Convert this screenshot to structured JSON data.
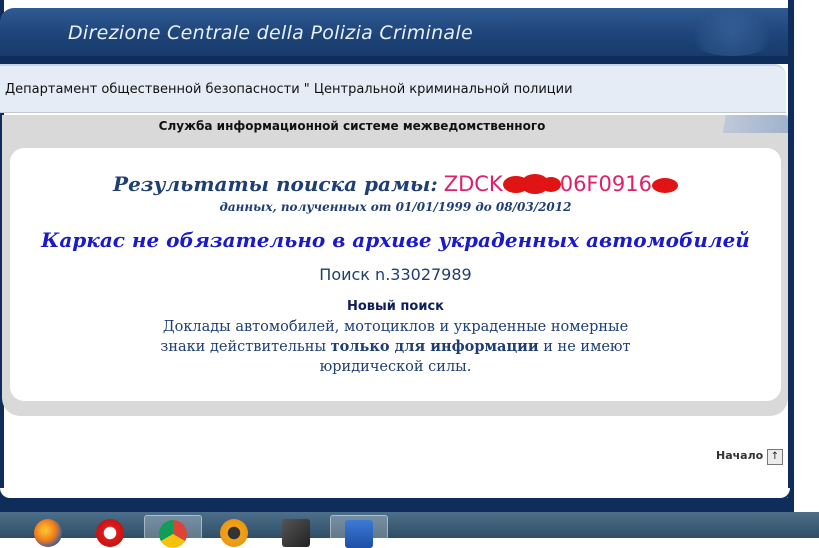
{
  "header": {
    "title": "Direzione Centrale della Polizia Criminale",
    "department": "Департамент общественной безопасности \" Центральной криминальной полиции",
    "service": "Служба информационной системе межведомственного"
  },
  "results": {
    "heading": "Результаты поиска рамы:",
    "vin_parts": [
      "ZDCK",
      "06F0916"
    ],
    "dates": "данных, полученных от 01/01/1999 до 08/03/2012",
    "notice": "Каркас не обязательно в архиве украденных автомобилей",
    "search_number": "Поиск n.33027989",
    "new_search": "Новый поиск",
    "disclaimer_before": "Доклады автомобилей, мотоциклов и украденные номерные знаки действительны ",
    "disclaimer_bold": "только для информации",
    "disclaimer_after": " и не имеют юридической силы."
  },
  "footer": {
    "top_link": "Начало",
    "top_arrow": "↑"
  },
  "taskbar": {
    "apps": [
      "firefox-icon",
      "opera-icon",
      "chrome-icon",
      "avast-icon",
      "winrar-icon",
      "word-icon"
    ]
  },
  "colors": {
    "banner": "#1e4478",
    "vin": "#e0206a",
    "notice": "#1a1ac8",
    "text": "#1f3e74"
  }
}
